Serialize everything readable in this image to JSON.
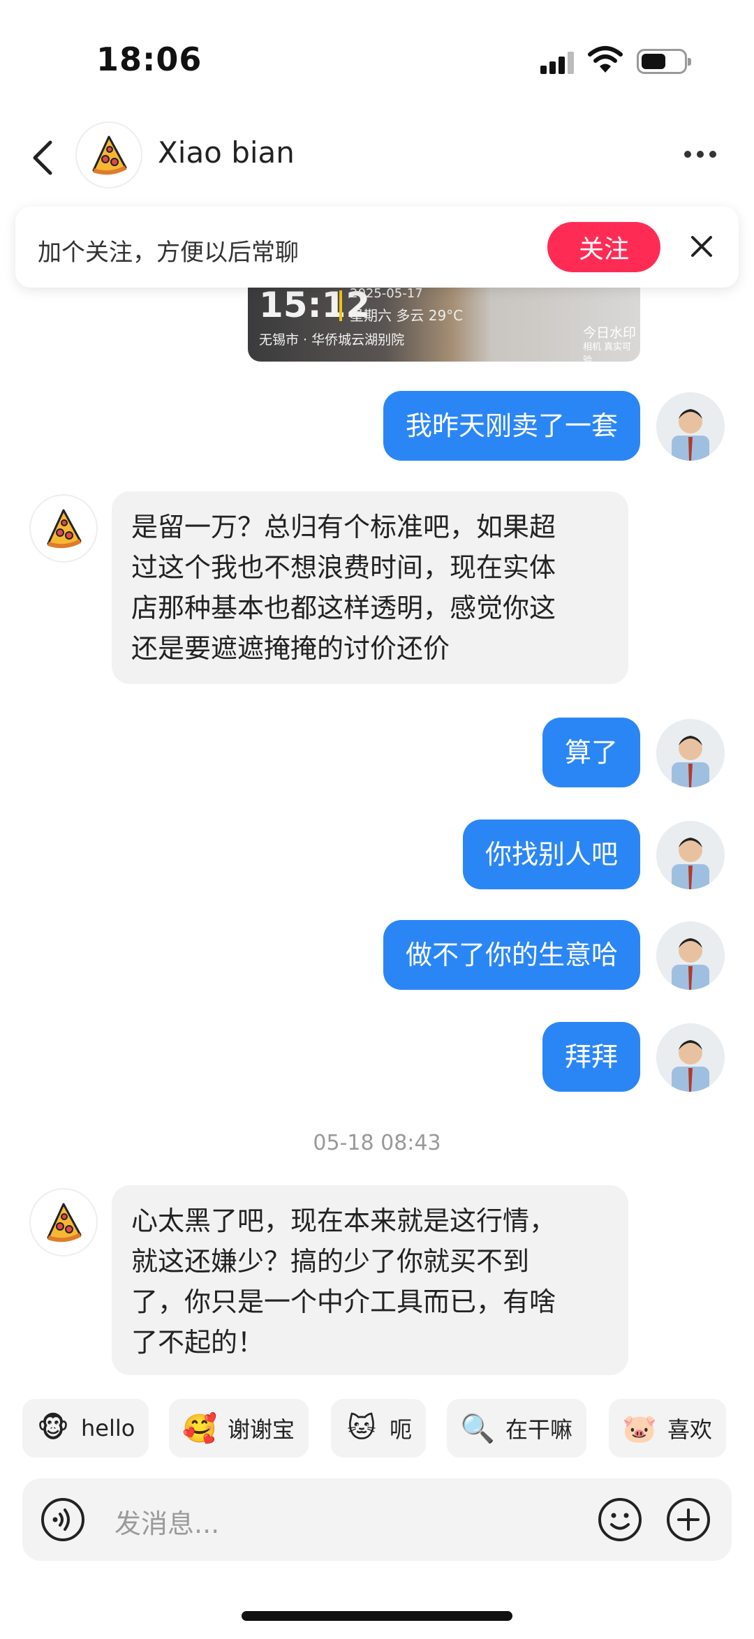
{
  "status_bar": {
    "time": "18:06"
  },
  "header": {
    "contact_name": "Xiao bian"
  },
  "follow_banner": {
    "text": "加个关注，方便以后常聊",
    "button_label": "关注"
  },
  "photo_watermark": {
    "time": "15:12",
    "date": "2025-05-17",
    "weather": "星期六 多云 29°C",
    "location": "无锡市 · 华侨城云湖别院",
    "brand": "今日水印",
    "verify": "相机 真实可验"
  },
  "messages": [
    {
      "sender": "me",
      "text": "我昨天刚卖了一套"
    },
    {
      "sender": "them",
      "lines": [
        "是留一万？总归有个标准吧，如果超",
        "过这个我也不想浪费时间，现在实体",
        "店那种基本也都这样透明，感觉你这",
        "还是要遮遮掩掩的讨价还价"
      ]
    },
    {
      "sender": "me",
      "text": "算了"
    },
    {
      "sender": "me",
      "text": "你找别人吧"
    },
    {
      "sender": "me",
      "text": "做不了你的生意哈"
    },
    {
      "sender": "me",
      "text": "拜拜"
    },
    {
      "sender": "them",
      "lines": [
        "心太黑了吧，现在本来就是这行情，",
        "就这还嫌少？搞的少了你就买不到",
        "了，你只是一个中介工具而已，有啥",
        "了不起的！"
      ]
    }
  ],
  "timestamp": "05-18 08:43",
  "quick_replies": [
    {
      "label": "hello",
      "emoji": "🐵"
    },
    {
      "label": "谢谢宝",
      "emoji": "🥰"
    },
    {
      "label": "呃",
      "emoji": "🐱"
    },
    {
      "label": "在干嘛",
      "emoji": "🔍"
    },
    {
      "label": "喜欢",
      "emoji": "🐷"
    }
  ],
  "input": {
    "placeholder": "发消息..."
  },
  "icons": {
    "back": "chevron-left-icon",
    "more": "more-dots-icon",
    "close": "close-icon",
    "voice": "voice-icon",
    "emoji": "smiley-icon",
    "plus": "plus-icon",
    "contact_avatar": "pizza-slice"
  },
  "colors": {
    "my_bubble": "#2b86f5",
    "their_bubble": "#f2f2f2",
    "follow_button": "#fe2c55"
  }
}
